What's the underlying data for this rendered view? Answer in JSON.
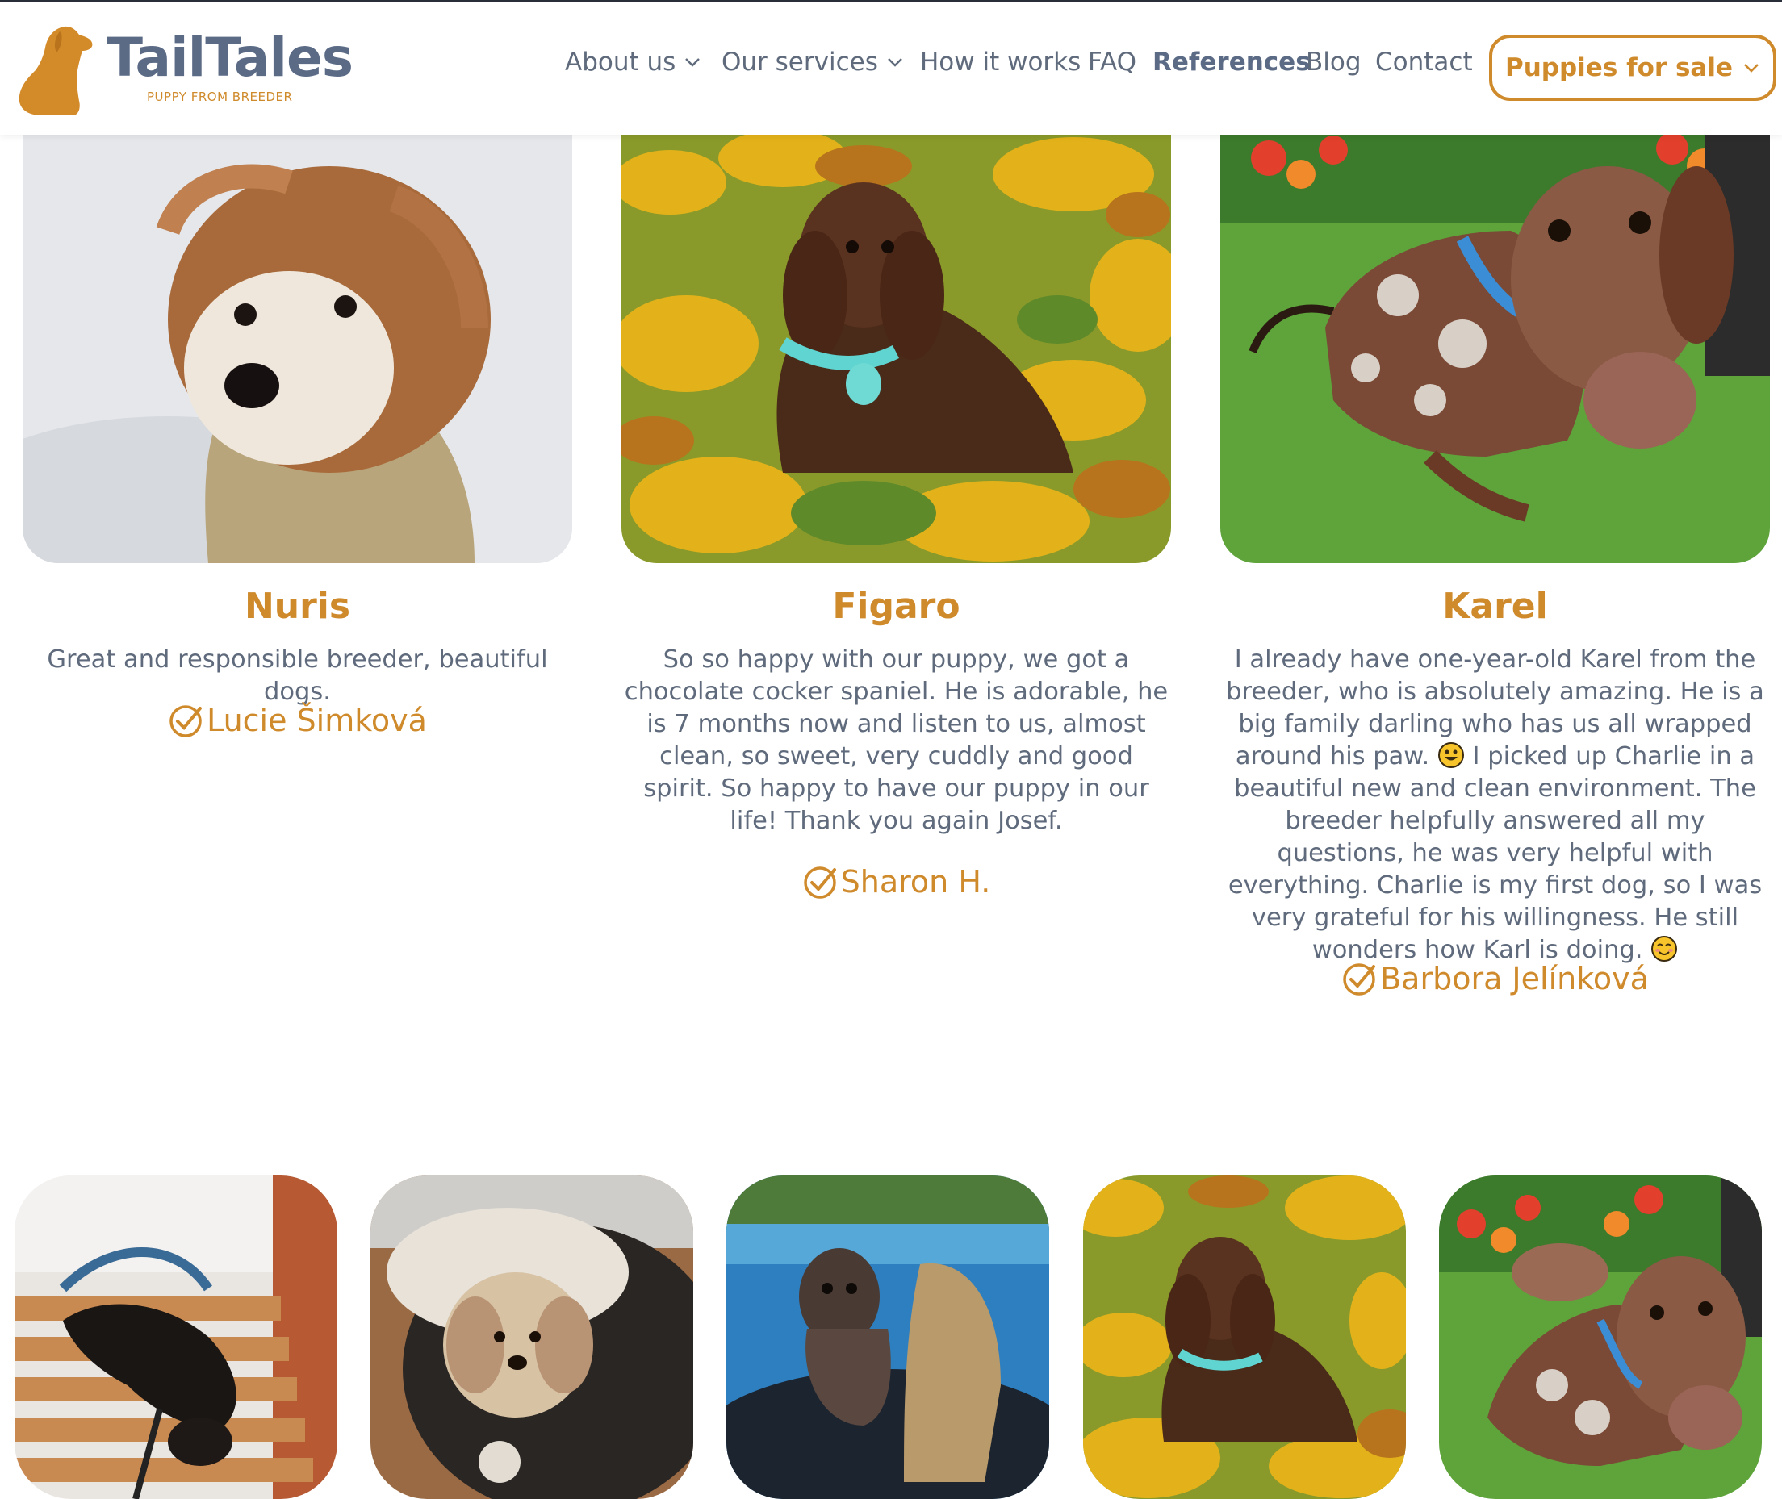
{
  "brand": {
    "name": "TailTales",
    "tagline": "PUPPY FROM BREEDER",
    "accent_color": "#cf8a2c",
    "text_color": "#5f6b7c",
    "logo_icon": "dog-silhouette-icon"
  },
  "nav": {
    "items": [
      {
        "label": "About us",
        "dropdown": true
      },
      {
        "label": "Our services",
        "dropdown": true
      },
      {
        "label": "How it works",
        "dropdown": false
      },
      {
        "label": "FAQ",
        "dropdown": false
      },
      {
        "label": "References",
        "dropdown": false,
        "active": true
      },
      {
        "label": "Blog",
        "dropdown": false
      },
      {
        "label": "Contact",
        "dropdown": false
      }
    ],
    "cta": {
      "label": "Puppies for sale",
      "dropdown": true
    }
  },
  "testimonials": [
    {
      "name": "Nuris",
      "text": "Great and responsible breeder, beautiful dogs.",
      "author": "Lucie Šimková",
      "photo": "small terrier puppy in beige jacket in snow"
    },
    {
      "name": "Figaro",
      "text": "So so happy with our puppy, we got a chocolate cocker spaniel. He is adorable, he is 7 months now and listen to us, almost clean, so sweet, very cuddly and good spirit. So happy to have our puppy in our life! Thank you again Josef.",
      "author": "Sharon H.",
      "photo": "chocolate cocker spaniel lying in autumn leaves"
    },
    {
      "name": "Karel",
      "text_part1": "I already have one-year-old Karel from the breeder, who is absolutely amazing. He is a big family darling who has us all wrapped around his paw.",
      "text_part2": "I picked up Charlie in a beautiful new and clean environment. The breeder helpfully answered all my questions, he was very helpful with everything. Charlie is my first dog, so I was very grateful for his willingness. He still wonders how Karl is doing.",
      "emoji1": "grinning-face-icon",
      "emoji2": "smiling-face-icon",
      "author": "Barbora Jelínková",
      "photo": "dapple dachshund on grass with tulips"
    }
  ],
  "gallery": [
    {
      "icon": "dachshund-on-wooden-bench-photo"
    },
    {
      "icon": "puppy-in-fluffy-bed-photo"
    },
    {
      "icon": "dachshund-in-pool-photo"
    },
    {
      "icon": "spaniel-in-leaves-photo"
    },
    {
      "icon": "dapple-dachshund-tulips-photo"
    }
  ]
}
